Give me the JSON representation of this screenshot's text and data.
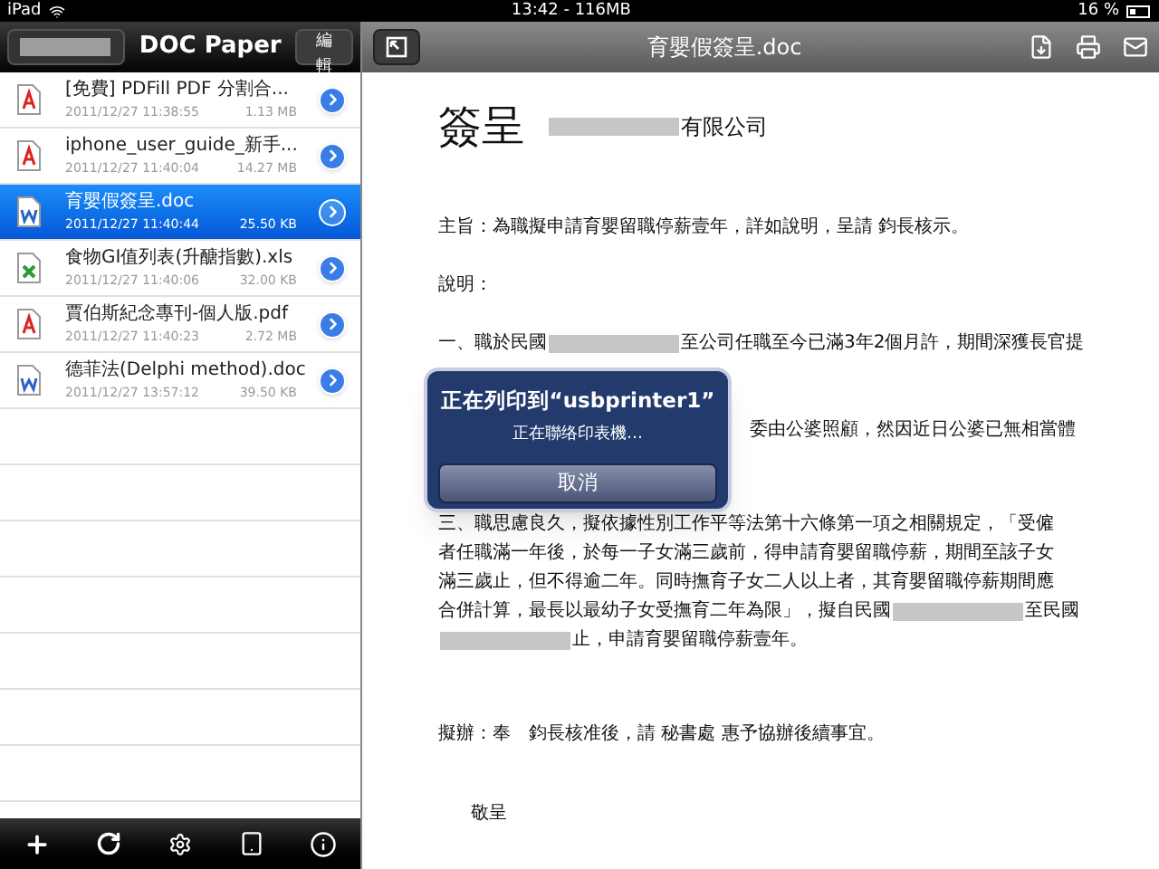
{
  "status_bar": {
    "device": "iPad",
    "time": "13:42 - 116MB",
    "battery": "16 %"
  },
  "file_list": {
    "title": "DOC Paper",
    "edit_button": "編輯",
    "files": [
      {
        "name": "[免費] PDFill PDF 分割合...",
        "date": "2011/12/27 11:38:55",
        "size": "1.13 MB",
        "kind": "pdf",
        "selected": false
      },
      {
        "name": "iphone_user_guide_新手...",
        "date": "2011/12/27 11:40:04",
        "size": "14.27 MB",
        "kind": "pdf",
        "selected": false
      },
      {
        "name": "育嬰假簽呈.doc",
        "date": "2011/12/27 11:40:44",
        "size": "25.50 KB",
        "kind": "doc",
        "selected": true
      },
      {
        "name": "食物GI值列表(升醣指數).xls",
        "date": "2011/12/27 11:40:06",
        "size": "32.00 KB",
        "kind": "xls",
        "selected": false
      },
      {
        "name": "賈伯斯紀念專刊-個人版.pdf",
        "date": "2011/12/27 11:40:23",
        "size": "2.72 MB",
        "kind": "pdf",
        "selected": false
      },
      {
        "name": "德菲法(Delphi method).doc",
        "date": "2011/12/27 13:57:12",
        "size": "39.50 KB",
        "kind": "doc",
        "selected": false
      }
    ]
  },
  "viewer": {
    "title": "育嬰假簽呈.doc",
    "document": {
      "heading": "簽呈",
      "heading_parts": [
        {
          "kind": "redacted"
        },
        {
          "kind": "text",
          "text": "有限公司"
        }
      ],
      "blocks": [
        {
          "kind": "normal",
          "lines": [
            {
              "kind": "normal",
              "parts": [
                {
                  "kind": "text",
                  "text": "主旨：為職擬申請育嬰留職停薪壹年，詳如說明，呈請 鈞長核示。"
                }
              ]
            }
          ]
        },
        {
          "kind": "normal",
          "lines": [
            {
              "kind": "normal",
              "parts": [
                {
                  "kind": "text",
                  "text": "說明："
                }
              ]
            }
          ]
        },
        {
          "kind": "continued",
          "lines": [
            {
              "kind": "normal",
              "parts": [
                {
                  "kind": "text",
                  "text": "一、職於民國"
                },
                {
                  "kind": "redacted"
                },
                {
                  "kind": "text",
                  "text": "至公司任職至今已滿3年2個月許，期間深獲長官提"
                }
              ]
            }
          ]
        },
        {
          "kind": "covered",
          "lines": [
            {
              "kind": "covered",
              "parts": [
                {
                  "kind": "text",
                  "text": "委由公婆照顧，然因近日公婆已無相當體"
                }
              ]
            }
          ]
        },
        {
          "kind": "normal",
          "lines": [
            {
              "kind": "normal",
              "parts": [
                {
                  "kind": "text",
                  "text": "三、職思慮良久，擬依據性別工作平等法第十六條第一項之相關規定，「受僱"
                }
              ]
            },
            {
              "kind": "normal",
              "parts": [
                {
                  "kind": "text",
                  "text": "者任職滿一年後，於每一子女滿三歲前，得申請育嬰留職停薪，期間至該子女"
                }
              ]
            },
            {
              "kind": "normal",
              "parts": [
                {
                  "kind": "text",
                  "text": "滿三歲止，但不得逾二年。同時撫育子女二人以上者，其育嬰留職停薪期間應"
                }
              ]
            },
            {
              "kind": "normal",
              "parts": [
                {
                  "kind": "text",
                  "text": "合併計算，最長以最幼子女受撫育二年為限」，擬自民國"
                },
                {
                  "kind": "redacted"
                },
                {
                  "kind": "text",
                  "text": "至民國"
                }
              ]
            },
            {
              "kind": "normal",
              "parts": [
                {
                  "kind": "redacted"
                },
                {
                  "kind": "text",
                  "text": " 止，申請育嬰留職停薪壹年。"
                }
              ]
            }
          ]
        },
        {
          "kind": "wide",
          "lines": [
            {
              "kind": "normal",
              "parts": [
                {
                  "kind": "text",
                  "text": "擬辦：奉　鈞長核准後，請 秘書處 惠予協辦後續事宜。"
                }
              ]
            }
          ]
        },
        {
          "kind": "normal",
          "lines": [
            {
              "kind": "closing",
              "parts": [
                {
                  "kind": "text",
                  "text": "敬呈"
                }
              ]
            }
          ]
        }
      ]
    },
    "dialog": {
      "title": "正在列印到“usbprinter1”",
      "message": "正在聯络印表機…",
      "cancel_button": "取消"
    }
  }
}
